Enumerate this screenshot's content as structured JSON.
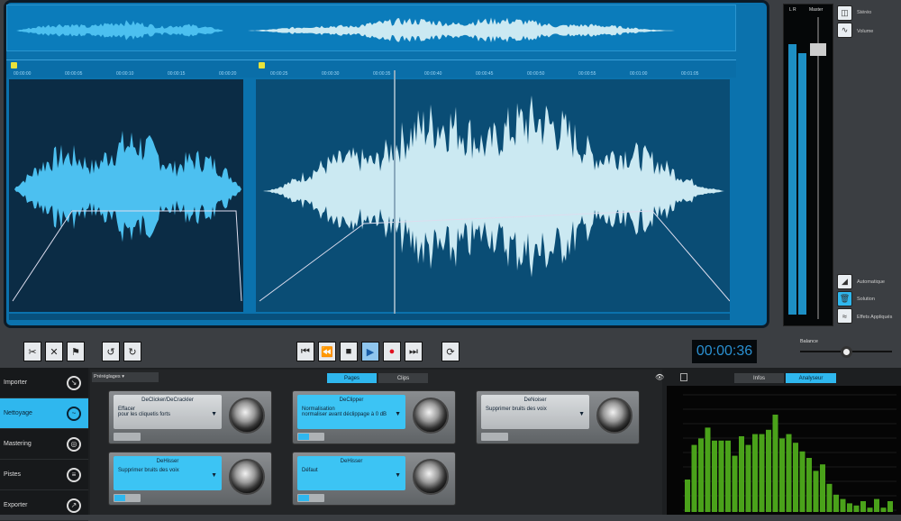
{
  "ruler": {
    "ticks": [
      "00:00:00",
      "00:00:05",
      "00:00:10",
      "00:00:15",
      "00:00:20",
      "00:00:25",
      "00:00:30",
      "00:00:35",
      "00:00:40",
      "00:00:45",
      "00:00:50",
      "00:00:55",
      "00:01:00",
      "00:01:05"
    ]
  },
  "meters": {
    "lr_label": "L R",
    "master_label": "Master",
    "left_level": 0.85,
    "right_level": 0.82,
    "master_fader": 0.9
  },
  "side_buttons": [
    {
      "label": "Stéréo",
      "icon": "stereo-icon"
    },
    {
      "label": "Volume",
      "icon": "volume-curve-icon"
    }
  ],
  "side_buttons_bottom": [
    {
      "label": "Automatique",
      "icon": "automation-icon"
    },
    {
      "label": "Solution",
      "icon": "trash-icon"
    },
    {
      "label": "Effets Appliqués",
      "icon": "effects-icon"
    }
  ],
  "balance": {
    "label": "Balance",
    "value": 0.5
  },
  "transport": {
    "time": "00:00:36"
  },
  "nav": [
    {
      "label": "Importer",
      "icon": "import-icon"
    },
    {
      "label": "Nettoyage",
      "icon": "clean-icon",
      "active": true
    },
    {
      "label": "Mastering",
      "icon": "mastering-icon"
    },
    {
      "label": "Pistes",
      "icon": "tracks-icon"
    },
    {
      "label": "Exporter",
      "icon": "export-icon"
    }
  ],
  "presets": {
    "label": "Préréglages"
  },
  "tabs": [
    {
      "label": "Pages",
      "active": true
    },
    {
      "label": "Clips"
    }
  ],
  "analysis_tabs": [
    {
      "label": "Infos"
    },
    {
      "label": "Analyseur",
      "active": true
    }
  ],
  "cards": [
    {
      "title": "DeClicker/DeCrackler",
      "line1": "Effacer",
      "line2": "pour les cliquetis forts",
      "style": "gray"
    },
    {
      "title": "DeClipper",
      "line1": "Normalisation",
      "line2": "normaliser avant déclippage à 0 dB",
      "style": "blue"
    },
    {
      "title": "DeNoiser",
      "line1": "Supprimer bruits des voix",
      "line2": "",
      "style": "gray"
    },
    {
      "title": "DeHisser",
      "line1": "Supprimer bruits des voix",
      "line2": "",
      "style": "blue"
    },
    {
      "title": "DeHisser",
      "line1": "Défaut",
      "line2": "",
      "style": "blue"
    }
  ],
  "spectrum": {
    "levels": [
      0.3,
      0.62,
      0.68,
      0.78,
      0.66,
      0.66,
      0.66,
      0.52,
      0.7,
      0.62,
      0.72,
      0.72,
      0.76,
      0.9,
      0.68,
      0.72,
      0.64,
      0.56,
      0.5,
      0.38,
      0.44,
      0.26,
      0.16,
      0.12,
      0.08,
      0.06,
      0.1,
      0.04,
      0.12,
      0.04,
      0.1
    ]
  },
  "colors": {
    "accent": "#2fb7ee",
    "waveform_left": "#4cc0f0",
    "waveform_right": "#cbe9f2",
    "spectrum": "#4aa21a"
  }
}
